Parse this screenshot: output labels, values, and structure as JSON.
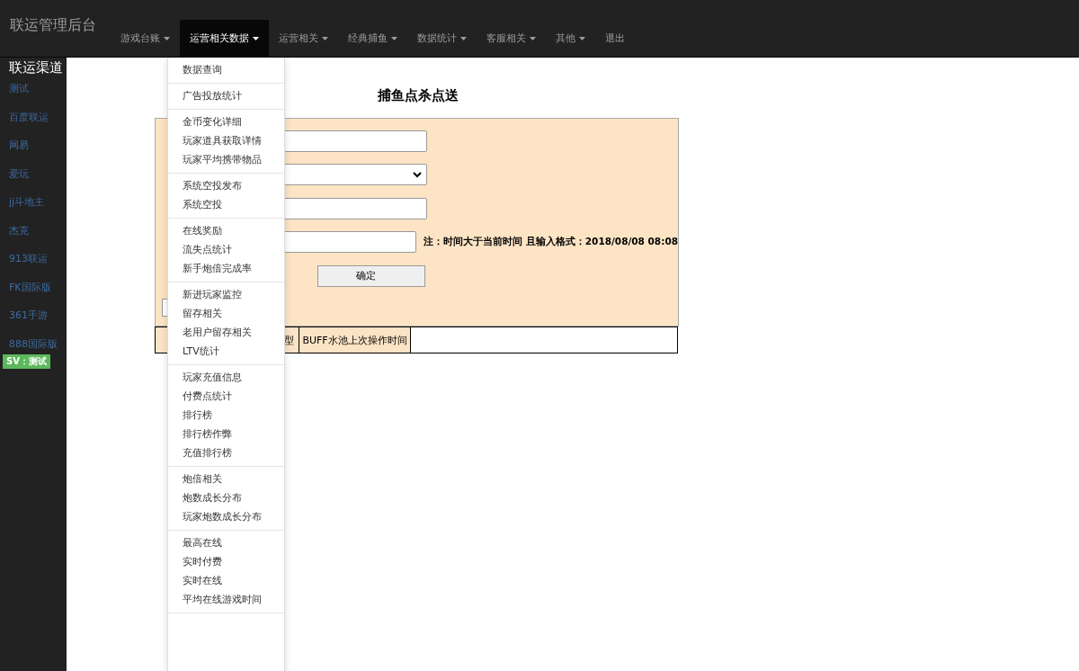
{
  "brand": "联运管理后台",
  "nav": [
    {
      "label": "游戏台账",
      "dropdown": true,
      "selected": false
    },
    {
      "label": "运营相关数据",
      "dropdown": true,
      "selected": true
    },
    {
      "label": "运营相关",
      "dropdown": true,
      "selected": false
    },
    {
      "label": "经典捕鱼",
      "dropdown": true,
      "selected": false
    },
    {
      "label": "数据统计",
      "dropdown": true,
      "selected": false
    },
    {
      "label": "客服相关",
      "dropdown": true,
      "selected": false
    },
    {
      "label": "其他",
      "dropdown": true,
      "selected": false
    },
    {
      "label": "退出",
      "dropdown": false,
      "selected": false
    }
  ],
  "sidebar": {
    "title": "联运渠道",
    "items": [
      "测试",
      "百度联运",
      "网易",
      "爱玩",
      "jj斗地主",
      "杰克",
      "913联运",
      "FK国际版",
      "361手游",
      "888国际版"
    ],
    "badge": "SV：测试"
  },
  "dropdown_menu": [
    [
      "数据查询"
    ],
    [
      "广告投放统计"
    ],
    [
      "金币变化详细",
      "玩家道具获取详情",
      "玩家平均携带物品"
    ],
    [
      "系统空投发布",
      "系统空投"
    ],
    [
      "在线奖励",
      "流失点统计",
      "新手炮倍完成率"
    ],
    [
      "新进玩家监控",
      "留存相关",
      "老用户留存相关",
      "LTV统计"
    ],
    [
      "玩家充值信息",
      "付费点统计",
      "排行榜",
      "排行榜作弊",
      "充值排行榜"
    ],
    [
      "炮倍相关",
      "炮数成长分布",
      "玩家炮数成长分布"
    ],
    [
      "最高在线",
      "实时付费",
      "实时在线",
      "平均在线游戏时间"
    ]
  ],
  "page_title": "捕鱼点杀点送",
  "form": {
    "fields": [
      {
        "kind": "input"
      },
      {
        "kind": "select"
      },
      {
        "kind": "input"
      },
      {
        "kind": "input",
        "note": "注：时间大于当前时间 且输入格式：2018/08/08 08:08"
      }
    ],
    "submit": "确定"
  },
  "table": {
    "columns": [
      "",
      "型",
      "BUFF水池上次操作时间",
      ""
    ]
  }
}
